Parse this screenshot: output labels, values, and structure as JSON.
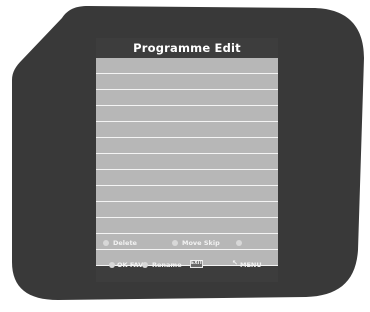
{
  "screen": {
    "title": "Programme Edit",
    "rows": [
      "",
      "",
      "",
      "",
      "",
      "",
      "",
      "",
      "",
      "",
      "",
      "",
      ""
    ],
    "footer": {
      "delete_label": "Delete",
      "move_skip_label": "Move Skip",
      "ok_fav_label": "OK FAV",
      "rename_label": "Rename",
      "exit_label": "EXIT",
      "menu_label": "MENU"
    }
  },
  "icons": {
    "delete": "red-button-icon",
    "move_skip": "green-button-icon",
    "skip": "yellow-button-icon",
    "ok": "ok-button-icon",
    "rename": "blue-button-icon",
    "exit": "exit-button-icon",
    "menu": "menu-button-icon"
  },
  "colors": {
    "bezel": "#393939",
    "screen_header": "#3d3d3d",
    "list_bg": "#b7b7b7",
    "separator": "#f4f4f4",
    "text": "#ffffff"
  }
}
